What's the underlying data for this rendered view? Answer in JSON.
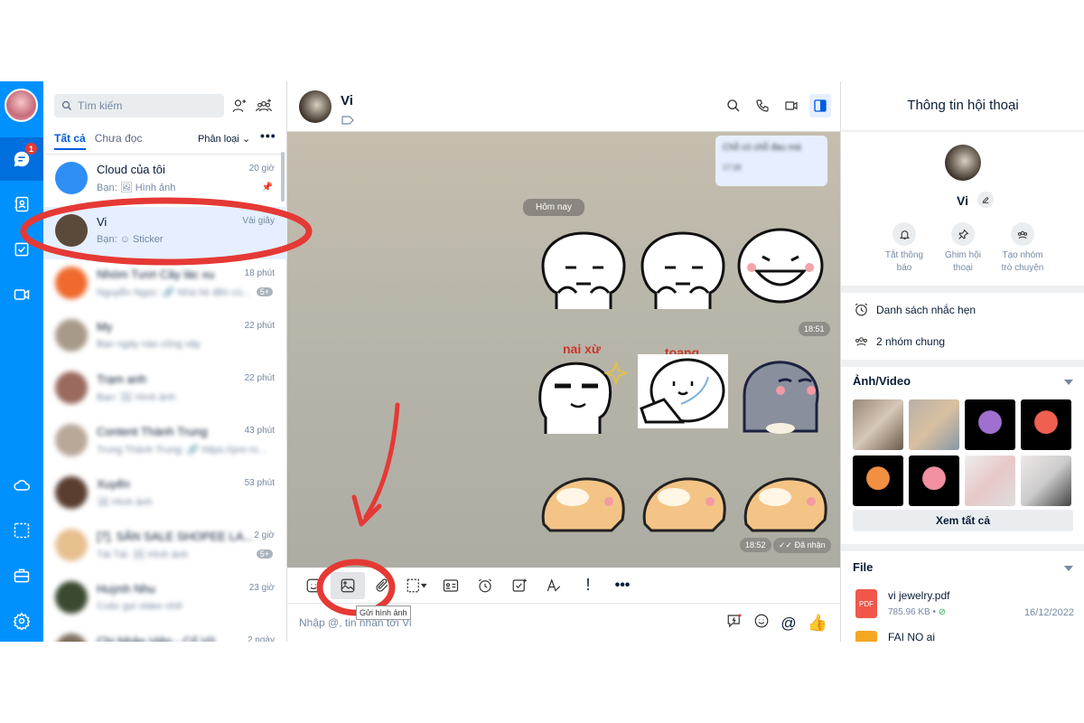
{
  "rail": {
    "unread_badge": "1",
    "icons": [
      "avatar",
      "chat-icon",
      "contacts-icon",
      "todo-icon",
      "video-call-icon",
      "cloud-icon",
      "screenshot-icon",
      "briefcase-icon",
      "settings-icon"
    ]
  },
  "list": {
    "search_placeholder": "Tìm kiếm",
    "tabs": [
      "Tất cả",
      "Chưa đọc"
    ],
    "filter": "Phân loại",
    "more": "•••",
    "items": [
      {
        "name": "Cloud của tôi",
        "sub": "Bạn: 🖼 Hình ảnh",
        "time": "20 giờ",
        "extra": "📌",
        "color": "#2f8ef4"
      },
      {
        "name": "Vi",
        "sub": "Bạn: ☺ Sticker",
        "time": "Vài giây",
        "extra": "",
        "color": "#5a4a3a"
      },
      {
        "name": "Nhóm Tươi Cây lác xu",
        "sub": "Nguyễn Ngọc: 🔗 Nhà hè đến cù...",
        "time": "18 phút",
        "extra": "5+",
        "color": "#f06a2e"
      },
      {
        "name": "My",
        "sub": "Bạn ngày nào cũng vậy",
        "time": "22 phút",
        "extra": "",
        "color": "#a89a88"
      },
      {
        "name": "Trạm anh",
        "sub": "Bạn: 🖼 Hình ảnh",
        "time": "22 phút",
        "extra": "",
        "color": "#9b6a5e"
      },
      {
        "name": "Content Thành Trung",
        "sub": "Trung Thành Trung: 🔗 https://pre-ro...",
        "time": "43 phút",
        "extra": "",
        "color": "#b8a898"
      },
      {
        "name": "Xuyến",
        "sub": "🖼 Hình ảnh",
        "time": "53 phút",
        "extra": "",
        "color": "#5a3e30"
      },
      {
        "name": "[7]. SĂN SALE SHOPEE LA...",
        "sub": "Tài Tài: 🖼 Hình ảnh",
        "time": "2 giờ",
        "extra": "5+",
        "color": "#e8c090"
      },
      {
        "name": "Huỳnh Nhu",
        "sub": "Cuộc gọi video nhỡ",
        "time": "23 giờ",
        "extra": "",
        "color": "#3a4a30"
      },
      {
        "name": "Chị Nhân Viên - Cổ Vũ",
        "sub": "",
        "time": "2 ngày",
        "extra": "",
        "color": "#807060"
      }
    ]
  },
  "chat": {
    "name": "Vi",
    "blurred_message": {
      "text": "Chỗ có chỗ đau mà",
      "time": "17:18"
    },
    "date_divider": "Hôm nay",
    "sticker_labels": [
      "nai xừ",
      "toang"
    ],
    "time1": "18:51",
    "time2": "18:52",
    "status": "Đã nhận",
    "tooltip": "Gửi hình ảnh",
    "input_placeholder": "Nhập @, tin nhắn tới Vi"
  },
  "info": {
    "title": "Thông tin hội thoại",
    "name": "Vi",
    "actions": [
      {
        "l1": "Tắt thông",
        "l2": "báo"
      },
      {
        "l1": "Ghim hội",
        "l2": "thoại"
      },
      {
        "l1": "Tạo nhóm",
        "l2": "trò chuyện"
      }
    ],
    "reminders": "Danh sách nhắc hẹn",
    "groups": "2 nhóm chung",
    "media_title": "Ảnh/Video",
    "see_all": "Xem tất cả",
    "file_title": "File",
    "files": [
      {
        "name": "vi jewelry.pdf",
        "size": "785.96 KB",
        "date": "16/12/2022",
        "type": "PDF"
      },
      {
        "name": "FAI NO ai",
        "size": "",
        "date": "",
        "type": ""
      }
    ]
  },
  "colors": {
    "brand": "#0091ff",
    "annotation": "#e53935"
  }
}
